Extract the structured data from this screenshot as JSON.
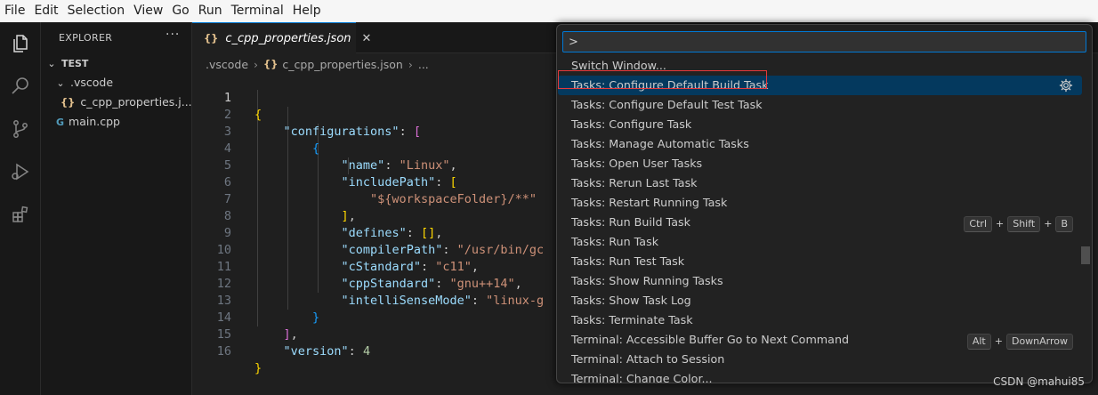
{
  "menubar": {
    "items": [
      "File",
      "Edit",
      "Selection",
      "View",
      "Go",
      "Run",
      "Terminal",
      "Help"
    ]
  },
  "activity_bar": {
    "icons": [
      "explorer-icon",
      "search-icon",
      "source-control-icon",
      "run-debug-icon",
      "extensions-icon"
    ]
  },
  "sidebar": {
    "title": "EXPLORER",
    "more": "···",
    "workspace": "TEST",
    "folder": ".vscode",
    "file1": "c_cpp_properties.j...",
    "file2": "main.cpp"
  },
  "tab": {
    "label": "c_cpp_properties.json",
    "close": "✕"
  },
  "breadcrumb": {
    "folder": ".vscode",
    "file": "c_cpp_properties.json",
    "ellipsis": "..."
  },
  "editor": {
    "line_numbers": [
      "1",
      "2",
      "3",
      "4",
      "5",
      "6",
      "7",
      "8",
      "9",
      "10",
      "11",
      "12",
      "13",
      "14",
      "15",
      "16"
    ],
    "l2_key": "\"configurations\"",
    "l4_key": "\"name\"",
    "l4_val": "\"Linux\"",
    "l5_key": "\"includePath\"",
    "l6_val": "\"${workspaceFolder}/**\"",
    "l8_key": "\"defines\"",
    "l9_key": "\"compilerPath\"",
    "l9_val": "\"/usr/bin/gc",
    "l10_key": "\"cStandard\"",
    "l10_val": "\"c11\"",
    "l11_key": "\"cppStandard\"",
    "l11_val": "\"gnu++14\"",
    "l12_key": "\"intelliSenseMode\"",
    "l12_val": "\"linux-g",
    "l15_key": "\"version\"",
    "l15_val": "4"
  },
  "palette": {
    "input_value": ">",
    "items": [
      "Switch Window...",
      "Tasks: Configure Default Build Task",
      "Tasks: Configure Default Test Task",
      "Tasks: Configure Task",
      "Tasks: Manage Automatic Tasks",
      "Tasks: Open User Tasks",
      "Tasks: Rerun Last Task",
      "Tasks: Restart Running Task",
      "Tasks: Run Build Task",
      "Tasks: Run Task",
      "Tasks: Run Test Task",
      "Tasks: Show Running Tasks",
      "Tasks: Show Task Log",
      "Tasks: Terminate Task",
      "Terminal: Accessible Buffer Go to Next Command",
      "Terminal: Attach to Session",
      "Terminal: Change Color..."
    ],
    "build_keys": [
      "Ctrl",
      "Shift",
      "B"
    ],
    "accessible_keys": [
      "Alt",
      "DownArrow"
    ],
    "plus": "+"
  },
  "watermark": "CSDN @mahui85",
  "colors": {
    "accent": "#0078d4",
    "highlight_box": "#e5393b",
    "focused_item": "#04395e"
  }
}
